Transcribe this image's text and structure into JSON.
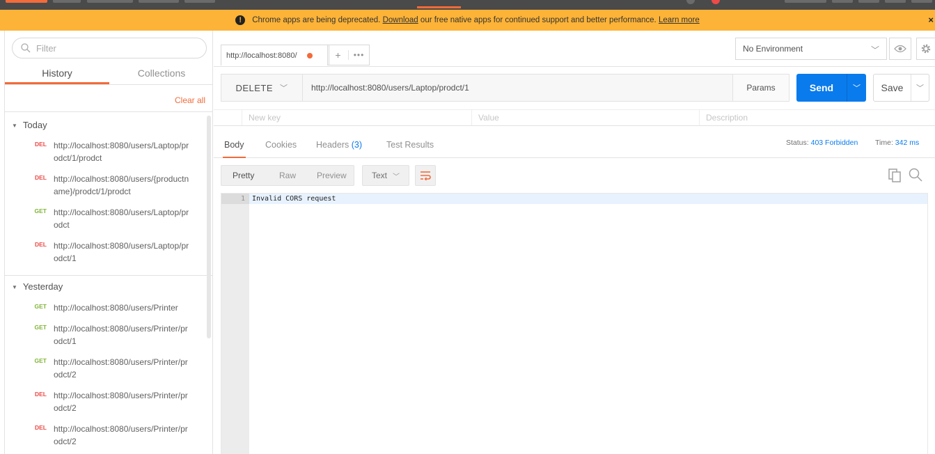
{
  "banner": {
    "text_before": "Chrome apps are being deprecated.",
    "download_link": "Download",
    "text_middle": "our free native apps for continued support and better performance.",
    "learn_more_link": "Learn more",
    "close": "×"
  },
  "sidebar": {
    "filter_placeholder": "Filter",
    "tabs": [
      "History",
      "Collections"
    ],
    "clear_all": "Clear all",
    "groups": [
      {
        "label": "Today",
        "items": [
          {
            "method": "DEL",
            "url": "http://localhost:8080/users/Laptop/prodct/1/prodct"
          },
          {
            "method": "DEL",
            "url": "http://localhost:8080/users/{productname}/prodct/1/prodct"
          },
          {
            "method": "GET",
            "url": "http://localhost:8080/users/Laptop/prodct"
          },
          {
            "method": "DEL",
            "url": "http://localhost:8080/users/Laptop/prodct/1"
          }
        ]
      },
      {
        "label": "Yesterday",
        "items": [
          {
            "method": "GET",
            "url": "http://localhost:8080/users/Printer"
          },
          {
            "method": "GET",
            "url": "http://localhost:8080/users/Printer/prodct/1"
          },
          {
            "method": "GET",
            "url": "http://localhost:8080/users/Printer/prodct/2"
          },
          {
            "method": "DEL",
            "url": "http://localhost:8080/users/Printer/prodct/2"
          },
          {
            "method": "DEL",
            "url": "http://localhost:8080/users/Printer/prodct/2"
          }
        ]
      }
    ]
  },
  "request_tab": {
    "title": "http://localhost:8080/",
    "add": "+",
    "more": "•••"
  },
  "environment": {
    "selected": "No Environment"
  },
  "request": {
    "method": "DELETE",
    "url": "http://localhost:8080/users/Laptop/prodct/1",
    "params_label": "Params",
    "send_label": "Send",
    "save_label": "Save"
  },
  "params_table": {
    "key_placeholder": "New key",
    "value_placeholder": "Value",
    "description_placeholder": "Description"
  },
  "response": {
    "tabs": {
      "body": "Body",
      "cookies": "Cookies",
      "headers": "Headers",
      "headers_count": "(3)",
      "test_results": "Test Results"
    },
    "status_label": "Status:",
    "status_value": "403 Forbidden",
    "time_label": "Time:",
    "time_value": "342 ms",
    "formats": [
      "Pretty",
      "Raw",
      "Preview"
    ],
    "type": "Text",
    "line_number": "1",
    "body": "Invalid CORS request"
  },
  "colors": {
    "accent": "#f26b3a",
    "send": "#097bed",
    "banner": "#fcb337",
    "delete_method": "#ed4b48",
    "get_method": "#80b536"
  }
}
